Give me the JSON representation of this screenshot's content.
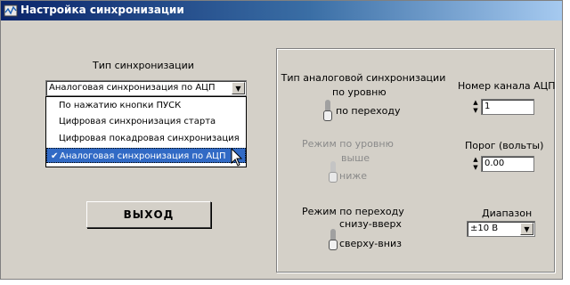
{
  "window": {
    "title": "Настройка синхронизации"
  },
  "left": {
    "sync_type_label": "Тип синхронизации",
    "sync_type_value": "Аналоговая синхронизация по АЦП",
    "dropdown": {
      "options": [
        "По нажатию кнопки ПУСК",
        "Цифровая синхронизация старта",
        "Цифровая покадровая синхронизация",
        "Аналоговая синхронизация по АЦП"
      ],
      "selected_index": 3
    },
    "exit_button": "ВЫХОД"
  },
  "right": {
    "analog_type": {
      "label": "Тип аналоговой синхронизации",
      "option_top": "по уровню",
      "option_bottom": "по переходу"
    },
    "level_mode": {
      "label": "Режим по уровню",
      "option_top": "выше",
      "option_bottom": "ниже"
    },
    "transition_mode": {
      "label": "Режим по переходу",
      "option_top": "снизу-вверх",
      "option_bottom": "сверху-вниз"
    },
    "adc_channel": {
      "label": "Номер канала АЦП",
      "value": "1"
    },
    "threshold": {
      "label": "Порог (вольты)",
      "value": "0.00"
    },
    "range": {
      "label": "Диапазон",
      "value": "±10 В"
    }
  }
}
